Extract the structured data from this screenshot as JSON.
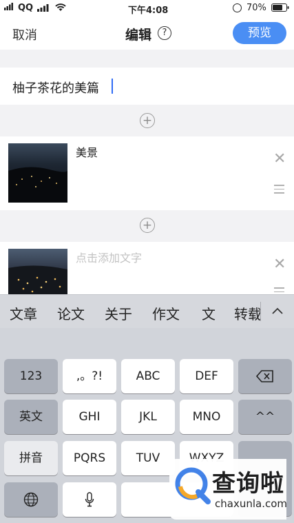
{
  "status_bar": {
    "carrier": "QQ",
    "time": "下午4:08",
    "battery": "70%"
  },
  "nav": {
    "cancel": "取消",
    "title": "编辑",
    "help": "?",
    "preview": "预览"
  },
  "article": {
    "title": "柚子茶花的美篇"
  },
  "add_symbol": "+",
  "items": [
    {
      "caption": "美景"
    },
    {
      "placeholder": "点击添加文字"
    }
  ],
  "keyboard": {
    "candidates": [
      "文章",
      "论文",
      "关于",
      "作文",
      "文",
      "转载"
    ],
    "rows": [
      [
        "123",
        ",。?!",
        "ABC",
        "DEF"
      ],
      [
        "英文",
        "GHI",
        "JKL",
        "MNO",
        "^^"
      ],
      [
        "拼音",
        "PQRS",
        "TUV",
        "WXYZ"
      ]
    ]
  },
  "watermark": {
    "brand": "查询啦",
    "url": "chaxunla.com"
  },
  "colors": {
    "accent": "#4a8ef4",
    "caret": "#2f6bf5",
    "keyboard_bg": "#d1d4da"
  }
}
